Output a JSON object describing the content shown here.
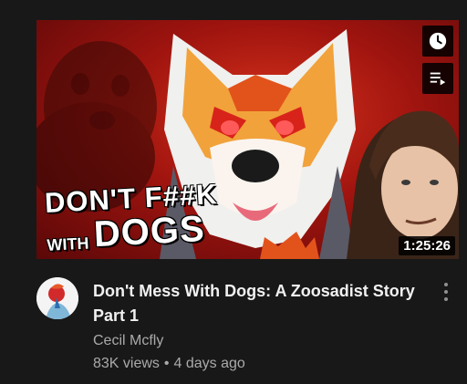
{
  "video": {
    "thumbnail_text_line1": "DON'T F##K",
    "thumbnail_text_small": "WITH",
    "thumbnail_text_big": "DOGS",
    "duration": "1:25:26",
    "title": "Don't Mess With Dogs: A Zoosadist Story Part 1",
    "channel": "Cecil Mcfly",
    "views": "83K views",
    "separator": "•",
    "age": "4 days ago"
  },
  "icons": {
    "watch_later": "clock-icon",
    "add_to_queue": "queue-icon",
    "more": "more-vert-icon"
  },
  "colors": {
    "background": "#181818",
    "title": "#f1f1f1",
    "secondary_text": "#aaaaaa",
    "thumbnail_red": "#c81e12"
  }
}
